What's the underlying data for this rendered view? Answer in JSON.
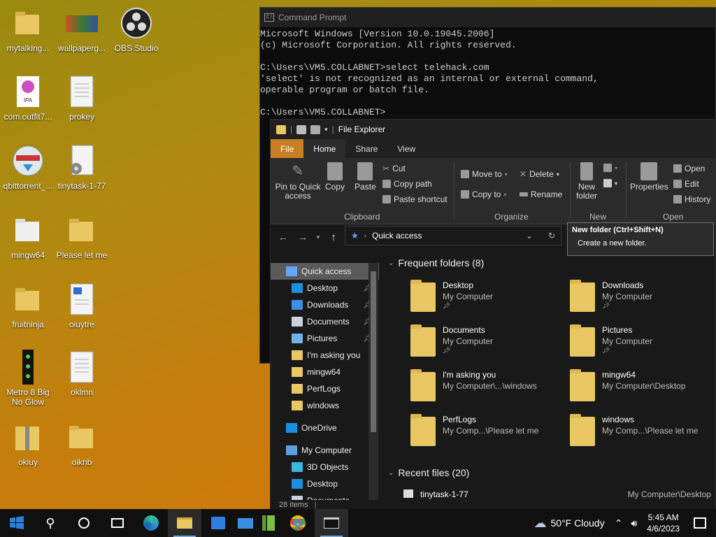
{
  "desktop": {
    "icons": [
      {
        "label": "mytalking..."
      },
      {
        "label": "wallpaperg..."
      },
      {
        "label": "OBS Studio"
      },
      {
        "label": "com.outfit7...",
        "badge": "IPA"
      },
      {
        "label": "prokey"
      },
      {
        "label": "qbittorrent_..."
      },
      {
        "label": "tinytask-1-77"
      },
      {
        "label": "mingw64"
      },
      {
        "label": "⁣Please let me"
      },
      {
        "label": "fruitninja"
      },
      {
        "label": "oiuytre"
      },
      {
        "label": "Metro 8 Big No Glow"
      },
      {
        "label": "oklmn"
      },
      {
        "label": "okiuy"
      },
      {
        "label": "oiknb"
      }
    ]
  },
  "cmd": {
    "title": "Command Prompt",
    "lines": [
      "Microsoft Windows [Version 10.0.19045.2006]",
      "(c) Microsoft Corporation. All rights reserved.",
      "",
      "C:\\Users\\VM5.COLLABNET>select telehack.com",
      "'select' is not recognized as an internal or external command,",
      "operable program or batch file.",
      "",
      "C:\\Users\\VM5.COLLABNET>"
    ]
  },
  "explorer": {
    "title": "File Explorer",
    "tabs": [
      "File",
      "Home",
      "Share",
      "View"
    ],
    "ribbon": {
      "pin": "Pin to Quick access",
      "copy": "Copy",
      "paste": "Paste",
      "cut": "Cut",
      "copy_path": "Copy path",
      "paste_shortcut": "Paste shortcut",
      "clipboard": "Clipboard",
      "move_to": "Move to",
      "copy_to": "Copy to",
      "delete": "Delete",
      "rename": "Rename",
      "organize": "Organize",
      "new_folder": "New folder",
      "new": "New",
      "properties": "Properties",
      "open": "Open",
      "edit": "Edit",
      "history": "History",
      "open_group": "Open"
    },
    "address": "Quick access",
    "tooltip": {
      "title": "New folder (Ctrl+Shift+N)",
      "desc": "Create a new folder."
    },
    "nav": [
      {
        "label": "Quick access",
        "level": 0,
        "pin": false,
        "color": "#5fa8ff"
      },
      {
        "label": "Desktop",
        "level": 1,
        "pin": true,
        "color": "#1a8fe0"
      },
      {
        "label": "Downloads",
        "level": 1,
        "pin": true,
        "color": "#3d8fe8"
      },
      {
        "label": "Documents",
        "level": 1,
        "pin": true,
        "color": "#c9d2de"
      },
      {
        "label": "Pictures",
        "level": 1,
        "pin": true,
        "color": "#6fb3e8"
      },
      {
        "label": "I'm  asking you",
        "level": 1,
        "pin": false,
        "color": "#e9c863"
      },
      {
        "label": "mingw64",
        "level": 1,
        "pin": false,
        "color": "#e9c863"
      },
      {
        "label": "PerfLogs",
        "level": 1,
        "pin": false,
        "color": "#e9c863"
      },
      {
        "label": "windows",
        "level": 1,
        "pin": false,
        "color": "#e9c863"
      },
      {
        "label": "",
        "level": 0,
        "pin": false,
        "color": ""
      },
      {
        "label": "OneDrive",
        "level": 0,
        "pin": false,
        "color": "#1a8fe0"
      },
      {
        "label": "",
        "level": 0,
        "pin": false,
        "color": ""
      },
      {
        "label": "My Computer",
        "level": 0,
        "pin": false,
        "color": "#5aa0e0"
      },
      {
        "label": "3D Objects",
        "level": 1,
        "pin": false,
        "color": "#38b8e0"
      },
      {
        "label": "Desktop",
        "level": 1,
        "pin": false,
        "color": "#1a8fe0"
      },
      {
        "label": "Documents",
        "level": 1,
        "pin": false,
        "color": "#c9d2de"
      }
    ],
    "frequent_header": "Frequent folders (8)",
    "frequent": [
      {
        "name": "Desktop",
        "path": "My Computer",
        "pinned": true
      },
      {
        "name": "Downloads",
        "path": "My Computer",
        "pinned": true
      },
      {
        "name": "Documents",
        "path": "My Computer",
        "pinned": true
      },
      {
        "name": "Pictures",
        "path": "My Computer",
        "pinned": true
      },
      {
        "name": "I'm  asking you",
        "path": "My Computer\\...\\windows",
        "pinned": false
      },
      {
        "name": "mingw64",
        "path": "My Computer\\Desktop",
        "pinned": false
      },
      {
        "name": "PerfLogs",
        "path": "My Comp...\\⁣Please let me",
        "pinned": false
      },
      {
        "name": "windows",
        "path": "My Comp...\\⁣Please let me",
        "pinned": false
      }
    ],
    "recent_header": "Recent files (20)",
    "recent": [
      {
        "name": "tinytask-1-77",
        "path": "My Computer\\Desktop"
      }
    ],
    "status": "28 items"
  },
  "taskbar": {
    "weather": "50°F  Cloudy",
    "time": "5:45 AM",
    "date": "4/6/2023"
  }
}
